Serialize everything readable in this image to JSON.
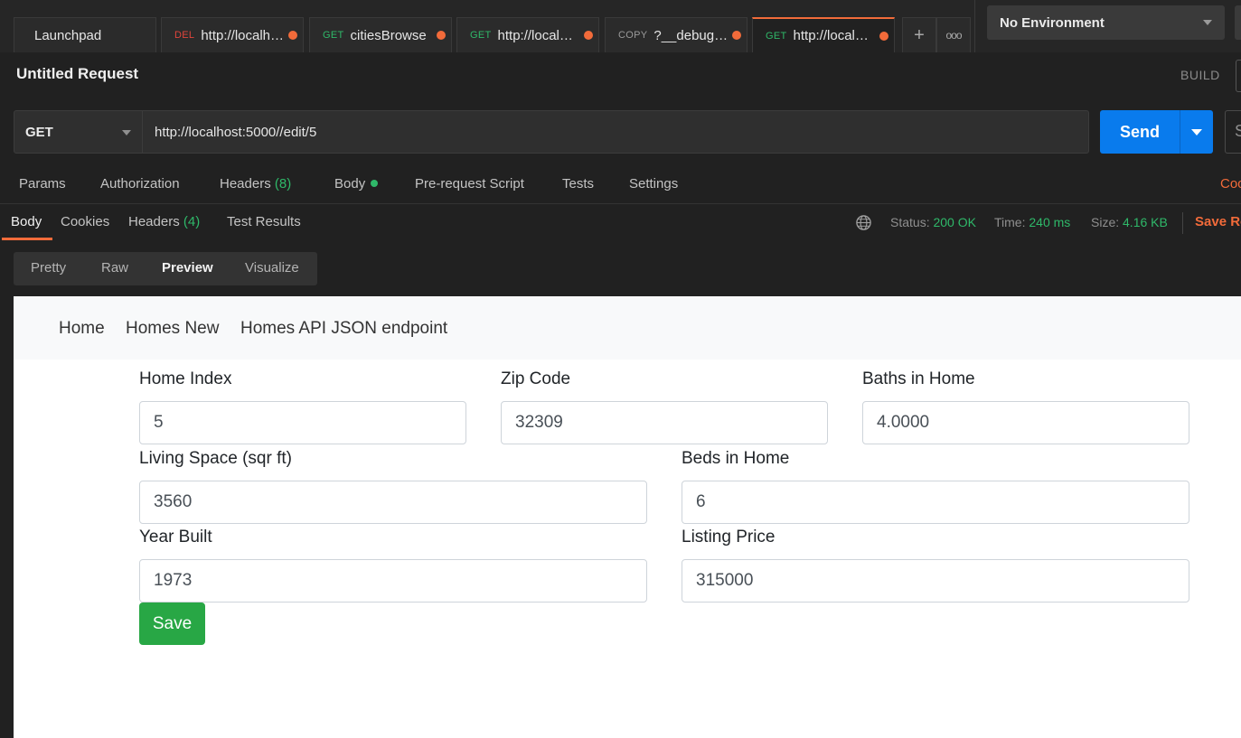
{
  "tabs": [
    {
      "method": "",
      "title": "Launchpad",
      "unsaved": false
    },
    {
      "method": "DEL",
      "title": "http://localho...",
      "unsaved": true
    },
    {
      "method": "GET",
      "title": "citiesBrowse",
      "unsaved": true
    },
    {
      "method": "GET",
      "title": "http://localho...",
      "unsaved": true
    },
    {
      "method": "COPY",
      "title": "?__debugge...",
      "unsaved": true
    },
    {
      "method": "GET",
      "title": "http://localho...",
      "unsaved": true
    }
  ],
  "tab_actions": {
    "new_tab": "+",
    "more": "ooo"
  },
  "environment": {
    "selected": "No Environment"
  },
  "request": {
    "title": "Untitled Request",
    "build_label": "BUILD",
    "method": "GET",
    "url": "http://localhost:5000//edit/5",
    "send_label": "Send",
    "save_edge_label": "S"
  },
  "request_tabs": {
    "params": "Params",
    "authorization": "Authorization",
    "headers": "Headers",
    "headers_count": "(8)",
    "body": "Body",
    "prerequest": "Pre-request Script",
    "tests": "Tests",
    "settings": "Settings",
    "cookies_link": "Coo"
  },
  "response": {
    "tabs": {
      "body": "Body",
      "cookies": "Cookies",
      "headers": "Headers",
      "headers_count": "(4)",
      "test_results": "Test Results"
    },
    "status_label": "Status:",
    "status": "200 OK",
    "time_label": "Time:",
    "time": "240 ms",
    "size_label": "Size:",
    "size": "4.16 KB",
    "save_label": "Save Re",
    "views": {
      "pretty": "Pretty",
      "raw": "Raw",
      "preview": "Preview",
      "visualize": "Visualize"
    }
  },
  "preview": {
    "nav": [
      "Home",
      "Homes New",
      "Homes API JSON endpoint"
    ],
    "fields": {
      "home_index": {
        "label": "Home Index",
        "value": "5"
      },
      "zip_code": {
        "label": "Zip Code",
        "value": "32309"
      },
      "baths": {
        "label": "Baths in Home",
        "value": "4.0000"
      },
      "living_space": {
        "label": "Living Space (sqr ft)",
        "value": "3560"
      },
      "beds": {
        "label": "Beds in Home",
        "value": "6"
      },
      "year_built": {
        "label": "Year Built",
        "value": "1973"
      },
      "listing_price": {
        "label": "Listing Price",
        "value": "315000"
      }
    },
    "save_label": "Save"
  },
  "colors": {
    "accent": "#f26b3a",
    "send": "#097bed",
    "success_text": "#2fb869",
    "save_button": "#28a745"
  }
}
